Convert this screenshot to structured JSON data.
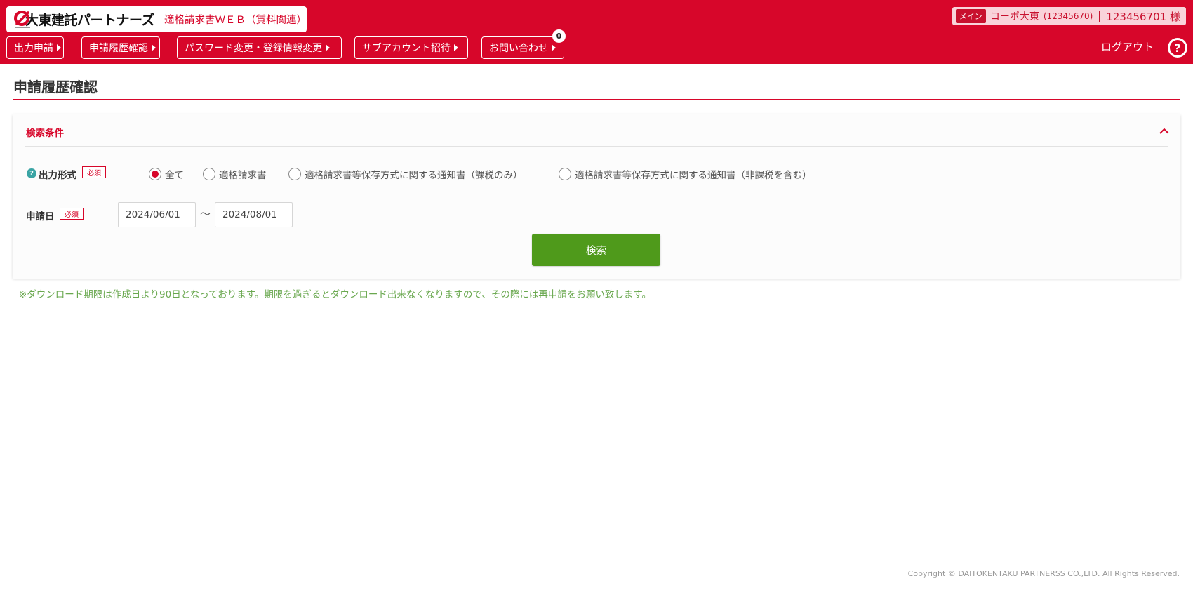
{
  "header": {
    "brand_name": "大東建託パートナーズ",
    "system_name": "適格請求書ＷＥＢ（賃料関連）",
    "brand_color": "#d7062a",
    "user": {
      "tag": "メイン",
      "name": "コーポ大東",
      "code": "(12345670)",
      "id": "123456701 様"
    },
    "nav": [
      {
        "label": "出力申請"
      },
      {
        "label": "申請履歴確認"
      },
      {
        "label": "パスワード変更・登録情報変更"
      },
      {
        "label": "サブアカウント招待"
      },
      {
        "label": "お問い合わせ",
        "badge": "0"
      }
    ],
    "logout_label": "ログアウト",
    "help_icon": "?"
  },
  "page": {
    "title": "申請履歴確認"
  },
  "search": {
    "heading": "検索条件",
    "output_format": {
      "help_icon": "?",
      "label": "出力形式",
      "required": "必須",
      "options": [
        {
          "label": "全て",
          "checked": true
        },
        {
          "label": "適格請求書",
          "checked": false
        },
        {
          "label": "適格請求書等保存方式に関する通知書（課税のみ）",
          "checked": false
        },
        {
          "label": "適格請求書等保存方式に関する通知書（非課税を含む）",
          "checked": false
        }
      ]
    },
    "date": {
      "label": "申請日",
      "required": "必須",
      "from": "2024/06/01",
      "separator": "～",
      "to": "2024/08/01"
    },
    "button_label": "検索",
    "button_color": "#4f9a1b"
  },
  "note": "※ダウンロード期限は作成日より90日となっております。期限を過ぎるとダウンロード出来なくなりますので、その際には再申請をお願い致します。",
  "footer": {
    "copyright": "Copyright © DAITOKENTAKU PARTNERSS CO.,LTD. All Rights Reserved."
  }
}
